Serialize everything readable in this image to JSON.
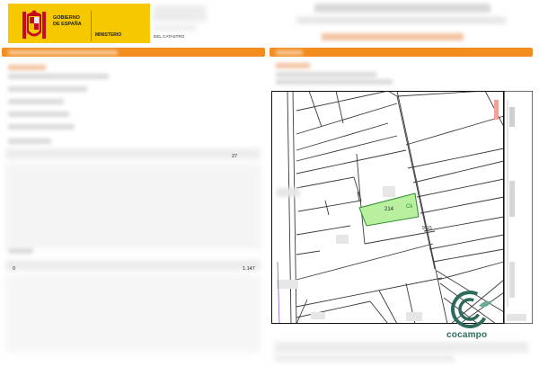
{
  "header": {
    "gov_line1": "GOBIERNO",
    "gov_line2": "DE ESPAÑA",
    "ministry": "MINISTERIO",
    "catastro_label": "DEL CATASTRO"
  },
  "left_panel": {
    "value_27": "27",
    "value_0": "0",
    "value_1147": "1.147"
  },
  "map": {
    "parcel_label": "214",
    "parcel_code": "Ck",
    "number_label": "9115"
  },
  "watermark": {
    "brand": "cocampo"
  },
  "colors": {
    "accent_orange": "#f28c1e",
    "gov_yellow": "#f5c800",
    "parcel_green": "#b8f0a0",
    "cocampo_green": "#2c6a5c"
  }
}
